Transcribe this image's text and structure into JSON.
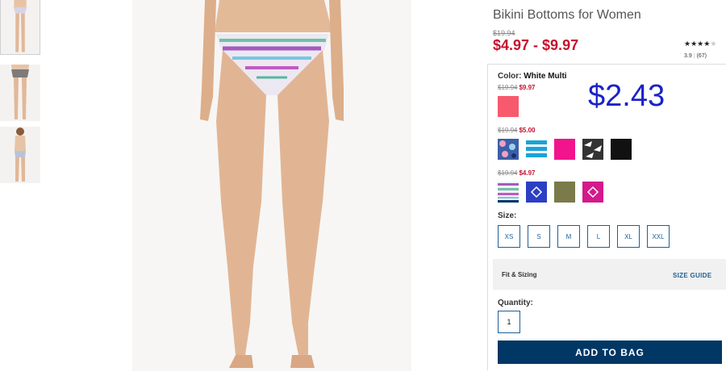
{
  "product": {
    "title": "Bikini Bottoms for Women",
    "original_price": "$19.94",
    "price_range": "$4.97 - $9.97",
    "rating_stars": 3.9,
    "rating_value": "3.9",
    "review_count": "(67)"
  },
  "color": {
    "label": "Color:",
    "selected": "White Multi",
    "groups": [
      {
        "was": "$19.94",
        "now": "$9.97",
        "swatches": [
          {
            "name": "coral",
            "color": "#f75a6c"
          }
        ]
      },
      {
        "was": "$19.94",
        "now": "$5.00",
        "swatches": [
          {
            "name": "blue-floral",
            "color": "#3b5fa8"
          },
          {
            "name": "aqua-stripe",
            "color": "#1aa3d6"
          },
          {
            "name": "hot-pink",
            "color": "#f2148c"
          },
          {
            "name": "black-white-print",
            "color": "#444444"
          },
          {
            "name": "black",
            "color": "#111111"
          }
        ]
      },
      {
        "was": "$19.94",
        "now": "$4.97",
        "swatches": [
          {
            "name": "white-multi",
            "color": "#e8e4f0"
          },
          {
            "name": "cobalt-diamond",
            "color": "#2b3fc4"
          },
          {
            "name": "olive",
            "color": "#7a7a4a"
          },
          {
            "name": "magenta-diamond",
            "color": "#d3198c"
          }
        ]
      }
    ]
  },
  "overlay_price": "$2.43",
  "sizes": {
    "label": "Size:",
    "options": [
      "XS",
      "S",
      "M",
      "L",
      "XL",
      "XXL"
    ]
  },
  "fit": {
    "label": "Fit & Sizing",
    "guide": "SIZE GUIDE"
  },
  "quantity": {
    "label": "Quantity:",
    "value": "1"
  },
  "add_to_bag": "ADD TO BAG"
}
